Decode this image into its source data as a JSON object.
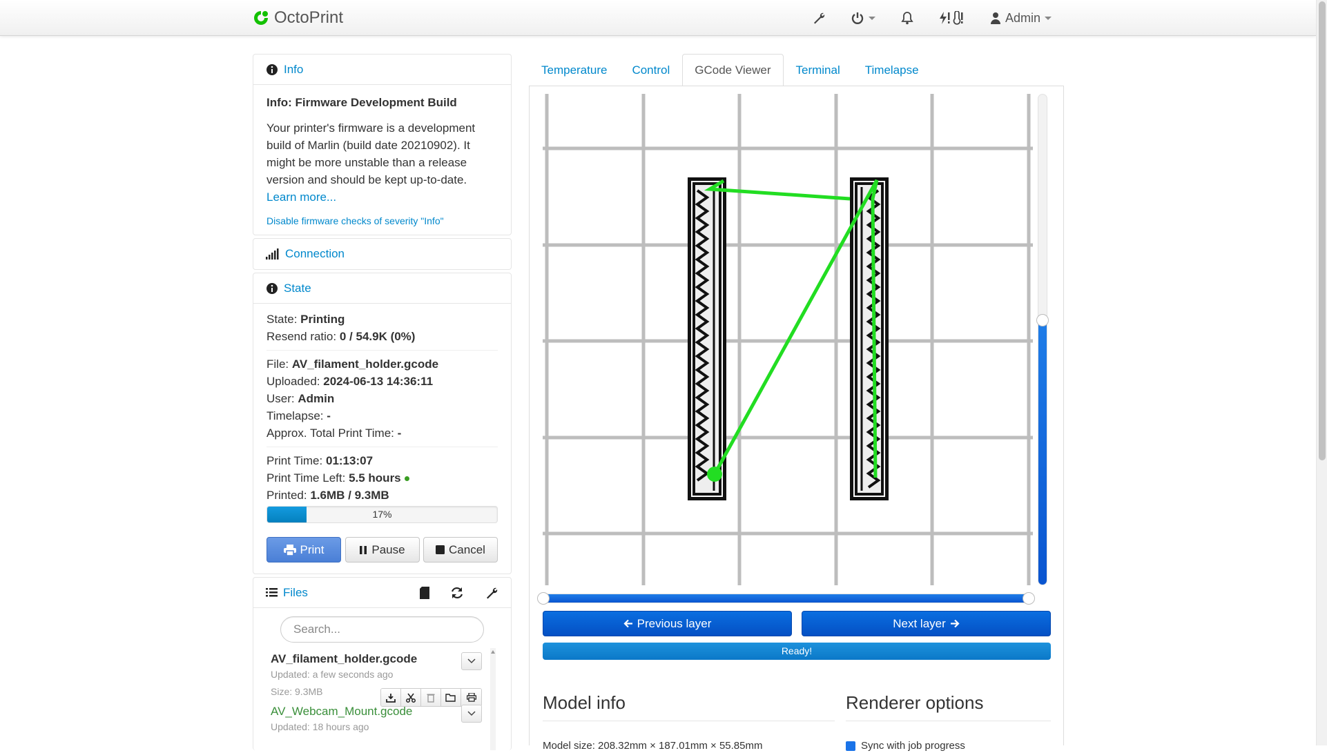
{
  "navbar": {
    "brand": "OctoPrint",
    "user": "Admin",
    "icons": [
      "wrench-icon",
      "power-icon",
      "bell-icon",
      "printer-warning-icon",
      "user-icon"
    ]
  },
  "sidebar": {
    "info": {
      "header": "Info",
      "title": "Info: Firmware Development Build",
      "text": "Your printer's firmware is a development build of Marlin (build date 20210902). It might be more unstable than a release version and should be kept up-to-date.",
      "learn_more": "Learn more...",
      "disable_link": "Disable firmware checks of severity \"Info\""
    },
    "connection": {
      "header": "Connection"
    },
    "state": {
      "header": "State",
      "state_label": "State:",
      "state_value": "Printing",
      "resend_label": "Resend ratio:",
      "resend_value": "0 / 54.9K (0%)",
      "file_label": "File:",
      "file_value": "AV_filament_holder.gcode",
      "uploaded_label": "Uploaded:",
      "uploaded_value": "2024-06-13 14:36:11",
      "user_label": "User:",
      "user_value": "Admin",
      "timelapse_label": "Timelapse:",
      "timelapse_value": "-",
      "total_label": "Approx. Total Print Time:",
      "total_value": "-",
      "print_time_label": "Print Time:",
      "print_time_value": "01:13:07",
      "time_left_label": "Print Time Left:",
      "time_left_value": "5.5 hours",
      "printed_label": "Printed:",
      "printed_value": "1.6MB / 9.3MB",
      "progress_percent": 17,
      "progress_text": "17%",
      "print_button": "Print",
      "pause_button": "Pause",
      "cancel_button": "Cancel"
    },
    "files": {
      "header": "Files",
      "search_placeholder": "Search...",
      "items": [
        {
          "name": "AV_filament_holder.gcode",
          "updated": "Updated: a few seconds ago",
          "size": "Size: 9.3MB"
        },
        {
          "name": "AV_Webcam_Mount.gcode",
          "updated": "Updated: 18 hours ago"
        }
      ]
    }
  },
  "main": {
    "tabs": [
      "Temperature",
      "Control",
      "GCode Viewer",
      "Terminal",
      "Timelapse"
    ],
    "active_tab": "GCode Viewer",
    "layer_slider_fraction": 0.54,
    "prev_layer": "Previous layer",
    "next_layer": "Next layer",
    "status": "Ready!",
    "model_info_title": "Model info",
    "model_size": "Model size: 208.32mm × 187.01mm × 55.85mm",
    "renderer_title": "Renderer options",
    "sync_option": "Sync with job progress"
  },
  "colors": {
    "accent": "#0088cc",
    "toolpath": "#22dd22",
    "layer_slider": "#0a55d0",
    "primary_button": "#4a7fd6"
  }
}
